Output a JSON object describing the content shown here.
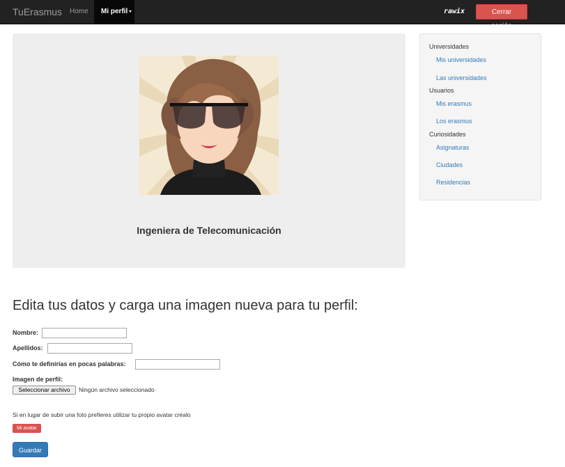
{
  "navbar": {
    "brand": "TuErasmus",
    "home": "Home",
    "profile_menu": "Mi perfil",
    "username": "rawix",
    "logout": "Cerrar sesión"
  },
  "profile": {
    "title": "Ingeniera de Telecomunicación"
  },
  "sidebar": {
    "group1": {
      "heading": "Universidades",
      "links": [
        "Mis universidades",
        "Las universidades"
      ]
    },
    "group2": {
      "heading": "Usuarios",
      "links": [
        "Mis erasmus",
        "Los erasmus"
      ]
    },
    "group3": {
      "heading": "Curiosidades",
      "links": [
        "Asignaturas",
        "Ciudades",
        "Residencias"
      ]
    }
  },
  "form": {
    "title": "Edita tus datos y carga una imagen nueva para tu perfil:",
    "nombre_label": "Nombre:",
    "nombre_value": "",
    "apellidos_label": "Apellidos:",
    "apellidos_value": "",
    "definicion_label": "Cómo te definirías en pocas palabras:",
    "definicion_value": "",
    "imagen_label": "Imagen de perfil:",
    "file_button": "Seleccionar archivo",
    "file_status": "Ningún archivo seleccionado",
    "hint": "Si en lugar de subir una foto prefieres utilizar tu propio avatar créalo",
    "avatar_button": "Mi avatar",
    "save_button": "Guardar"
  },
  "colors": {
    "navbar": "#222222",
    "danger": "#d9534f",
    "primary": "#337ab7",
    "link": "#337ab7",
    "card": "#eeeeee"
  }
}
